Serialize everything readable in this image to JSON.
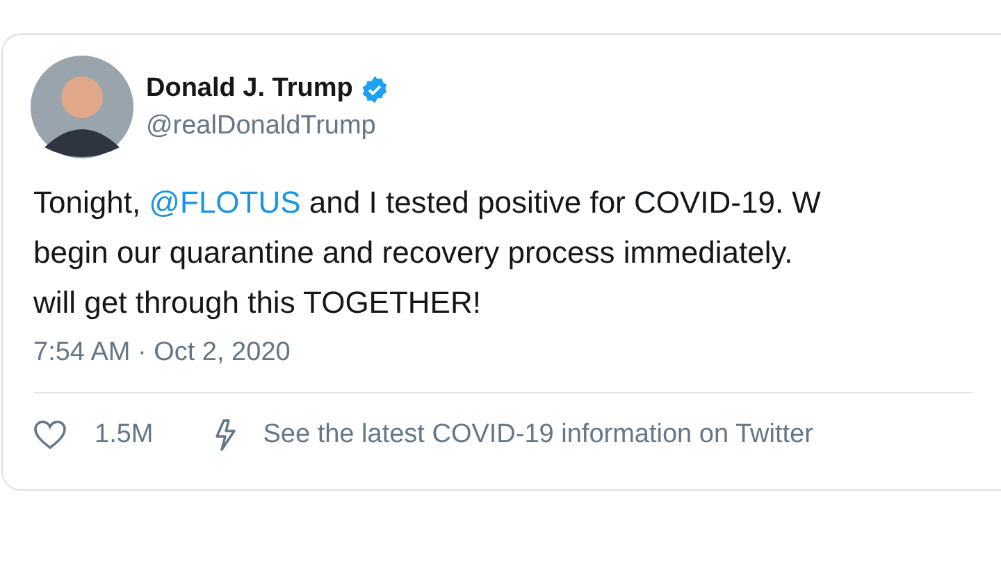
{
  "tweet": {
    "author": {
      "name": "Donald J. Trump",
      "verified": true,
      "handle": "@realDonaldTrump"
    },
    "lines": [
      [
        {
          "kind": "plain",
          "text": "Tonight, "
        },
        {
          "kind": "mention",
          "text": "@FLOTUS"
        },
        {
          "kind": "plain",
          "text": " and I tested positive for COVID-19. W"
        }
      ],
      [
        {
          "kind": "plain",
          "text": "begin our quarantine and recovery process immediately."
        }
      ],
      [
        {
          "kind": "plain",
          "text": "will get through this TOGETHER!"
        }
      ]
    ],
    "timestamp": "7:54 AM · Oct 2, 2020",
    "likes": "1.5M",
    "info_link": "See the latest COVID-19 information on Twitter"
  }
}
